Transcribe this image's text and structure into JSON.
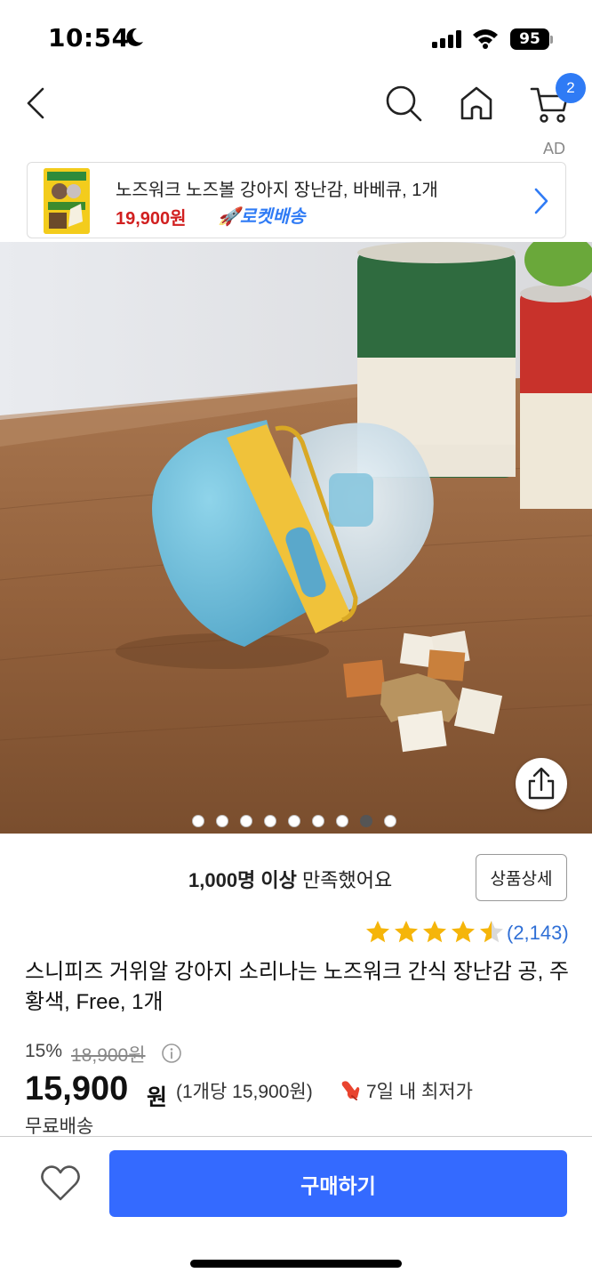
{
  "status_bar": {
    "time": "10:54",
    "battery": "95"
  },
  "nav": {
    "cart_count": "2"
  },
  "ad": {
    "label": "AD",
    "title": "노즈워크 노즈볼 강아지 장난감, 바베큐, 1개",
    "price": "19,900원",
    "delivery": "🚀로켓배송"
  },
  "gallery": {
    "total_images": 9,
    "active_index": 7
  },
  "info": {
    "satisfied_bold": "1,000명 이상",
    "satisfied_rest": " 만족했어요",
    "detail_button": "상품상세",
    "rating": 4.5,
    "review_count": "(2,143)",
    "product_title": "스니피즈 거위알 강아지 소리나는 노즈워크 간식 장난감 공, 주황색, Free, 1개",
    "discount": "15%",
    "original_price": "18,900원",
    "sale_price": "15,900",
    "sale_unit": "원",
    "unit_price": "(1개당 15,900원)",
    "lowest_label": "7일 내 최저가",
    "shipping": "무료배송"
  },
  "bottom": {
    "buy_label": "구매하기"
  },
  "colors": {
    "accent": "#346aff",
    "price_red": "#d11f1f",
    "star": "#f5b50a",
    "link": "#2f6fd6"
  }
}
